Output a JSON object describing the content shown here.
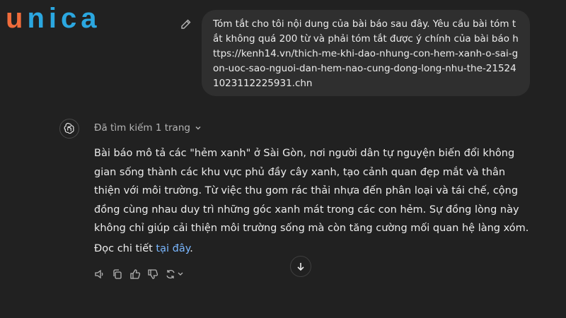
{
  "brand": {
    "logo_first": "u",
    "logo_rest": "nica",
    "colors": {
      "first": "#ef6c3b",
      "rest": "#2ba7e0"
    }
  },
  "user_message": {
    "text": "Tóm tắt cho tôi nội dung của bài báo sau đây. Yêu cầu bài tóm tắt không quá 200 từ và phải tóm tắt được ý chính của bài báo https://kenh14.vn/thich-me-khi-dao-nhung-con-hem-xanh-o-sai-gon-uoc-sao-nguoi-dan-hem-nao-cung-dong-long-nhu-the-215241023112225931.chn",
    "edit_icon": "pencil-icon"
  },
  "assistant": {
    "avatar_icon": "openai-logo-icon",
    "search_status": "Đã tìm kiếm 1 trang",
    "answer": "Bài báo mô tả các \"hẻm xanh\" ở Sài Gòn, nơi người dân tự nguyện biến đổi không gian sống thành các khu vực phủ đầy cây xanh, tạo cảnh quan đẹp mắt và thân thiện với môi trường. Từ việc thu gom rác thải nhựa đến phân loại và tái chế, cộng đồng cùng nhau duy trì những góc xanh mát trong các con hẻm. Sự đồng lòng này không chỉ giúp cải thiện môi trường sống mà còn tăng cường mối quan hệ làng xóm.",
    "more_prefix": "Đọc chi tiết ",
    "more_link": "tại đây",
    "more_suffix": "."
  },
  "actions": {
    "icons": [
      "speaker-icon",
      "copy-icon",
      "thumbs-up-icon",
      "thumbs-down-icon",
      "regenerate-icon"
    ]
  },
  "scroll": {
    "icon": "arrow-down-icon"
  }
}
